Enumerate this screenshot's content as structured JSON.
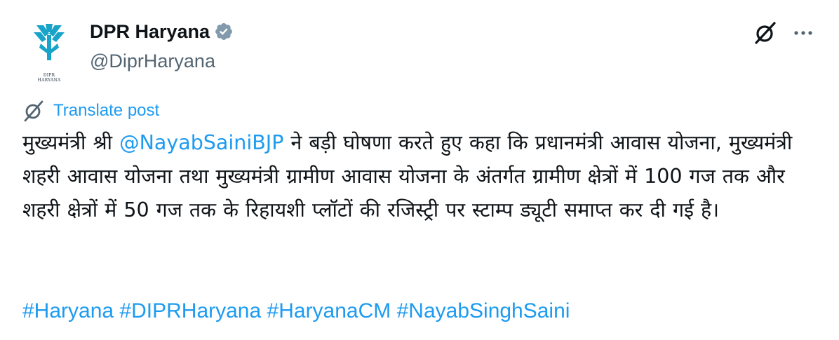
{
  "author": {
    "display_name": "DPR Haryana",
    "handle": "@DiprHaryana",
    "avatar_text": "DIPR HARYANA",
    "verified": true
  },
  "actions": {
    "grok_icon": "grok-icon",
    "more_icon": "more-icon"
  },
  "translate": {
    "label": "Translate post",
    "icon": "translate-icon"
  },
  "post": {
    "text_before": "मुख्यमंत्री श्री ",
    "mention": "@NayabSainiBJP",
    "text_after": " ने बड़ी घोषणा करते हुए कहा कि प्रधानमंत्री आवास योजना, मुख्यमंत्री शहरी आवास योजना तथा मुख्यमंत्री ग्रामीण आवास योजना के अंतर्गत ग्रामीण क्षेत्रों में 100 गज तक और शहरी क्षेत्रों में 50 गज तक के रिहायशी प्लॉटों की रजिस्ट्री पर स्टाम्प ड्यूटी समाप्त कर दी गई है।",
    "hashtags": [
      "#Haryana",
      "#DIPRHaryana",
      "#HaryanaCM",
      "#NayabSinghSaini"
    ]
  },
  "colors": {
    "link": "#1d9bf0",
    "text": "#0f1419",
    "secondary": "#536471",
    "logo": "#1aa3c8"
  }
}
